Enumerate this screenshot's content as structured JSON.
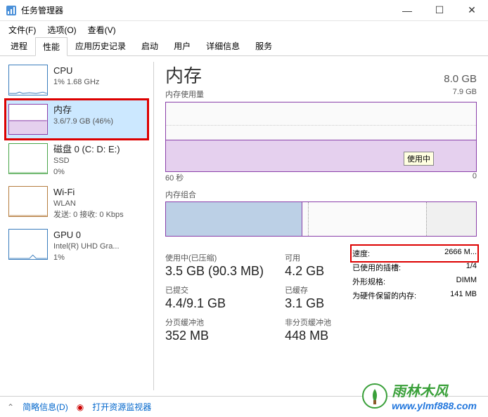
{
  "titlebar": {
    "title": "任务管理器"
  },
  "menubar": {
    "file": "文件(F)",
    "options": "选项(O)",
    "view": "查看(V)"
  },
  "tabs": [
    "进程",
    "性能",
    "应用历史记录",
    "启动",
    "用户",
    "详细信息",
    "服务"
  ],
  "active_tab": 1,
  "sidebar": [
    {
      "title": "CPU",
      "line2": "1% 1.68 GHz",
      "type": "cpu"
    },
    {
      "title": "内存",
      "line2": "3.6/7.9 GB (46%)",
      "type": "mem",
      "selected": true
    },
    {
      "title": "磁盘 0 (C: D: E:)",
      "line2": "SSD",
      "line3": "0%",
      "type": "disk"
    },
    {
      "title": "Wi-Fi",
      "line2": "WLAN",
      "line3": "发送: 0 接收: 0 Kbps",
      "type": "wifi"
    },
    {
      "title": "GPU 0",
      "line2": "Intel(R) UHD Gra...",
      "line3": "1%",
      "type": "gpu"
    }
  ],
  "main": {
    "title": "内存",
    "total": "8.0 GB",
    "usage_label": "内存使用量",
    "usage_right": "7.9 GB",
    "tooltip": "使用中",
    "axis_left": "60 秒",
    "axis_right": "0",
    "comp_label": "内存组合",
    "stats": {
      "in_use_label": "使用中(已压缩)",
      "in_use": "3.5 GB (90.3 MB)",
      "avail_label": "可用",
      "avail": "4.2 GB",
      "commit_label": "已提交",
      "commit": "4.4/9.1 GB",
      "cached_label": "已缓存",
      "cached": "3.1 GB",
      "paged_label": "分页缓冲池",
      "paged": "352 MB",
      "nonpaged_label": "非分页缓冲池",
      "nonpaged": "448 MB"
    },
    "kv": {
      "speed_k": "速度:",
      "speed_v": "2666 M...",
      "slots_k": "已使用的插槽:",
      "slots_v": "1/4",
      "form_k": "外形规格:",
      "form_v": "DIMM",
      "reserved_k": "为硬件保留的内存:",
      "reserved_v": "141 MB"
    }
  },
  "footer": {
    "fewer": "简略信息(D)",
    "monitor": "打开资源监视器"
  },
  "watermark": {
    "brand": "雨林木风",
    "url": "www.ylmf888.com"
  }
}
